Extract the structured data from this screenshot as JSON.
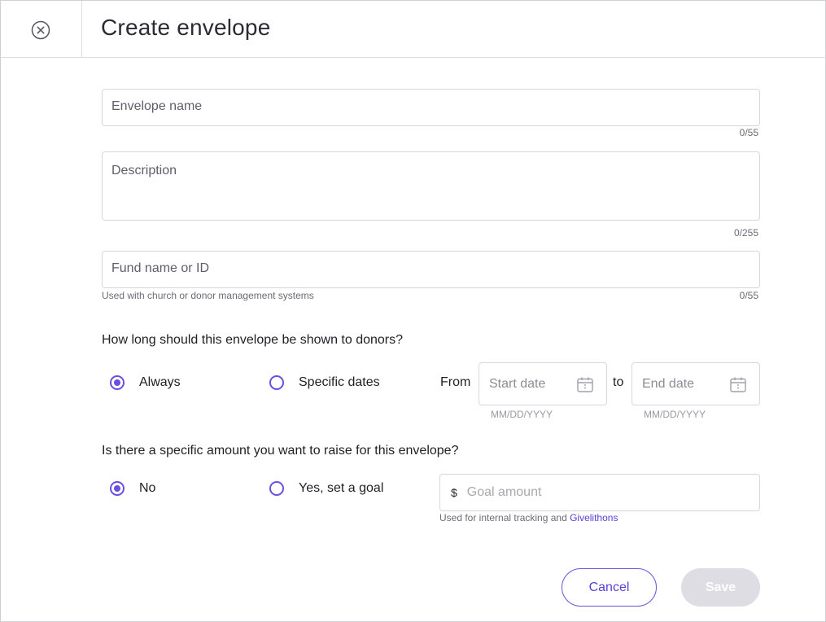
{
  "header": {
    "title": "Create envelope",
    "close_icon": "close-circle-icon"
  },
  "form": {
    "envelope_name": {
      "placeholder": "Envelope name",
      "value": "",
      "counter": "0/55"
    },
    "description": {
      "placeholder": "Description",
      "value": "",
      "counter": "0/255"
    },
    "fund": {
      "placeholder": "Fund name or ID",
      "value": "",
      "counter": "0/55",
      "helper": "Used with church or donor management systems"
    }
  },
  "duration": {
    "question": "How long should this envelope be shown to donors?",
    "options": [
      {
        "label": "Always",
        "checked": true
      },
      {
        "label": "Specific dates",
        "checked": false
      }
    ],
    "from_label": "From",
    "to_label": "to",
    "start_date": {
      "placeholder": "Start date",
      "hint": "MM/DD/YYYY"
    },
    "end_date": {
      "placeholder": "End date",
      "hint": "MM/DD/YYYY"
    }
  },
  "goal": {
    "question": "Is there a specific amount you want to raise for this envelope?",
    "options": [
      {
        "label": "No",
        "checked": true
      },
      {
        "label": "Yes, set a goal",
        "checked": false
      }
    ],
    "currency_symbol": "$",
    "amount_placeholder": "Goal amount",
    "helper_prefix": "Used for internal tracking and ",
    "helper_link": "Givelithons"
  },
  "actions": {
    "cancel_label": "Cancel",
    "save_label": "Save"
  },
  "colors": {
    "accent": "#6b4fe0",
    "link": "#5b3fd6",
    "disabled_button": "#dddde3"
  }
}
